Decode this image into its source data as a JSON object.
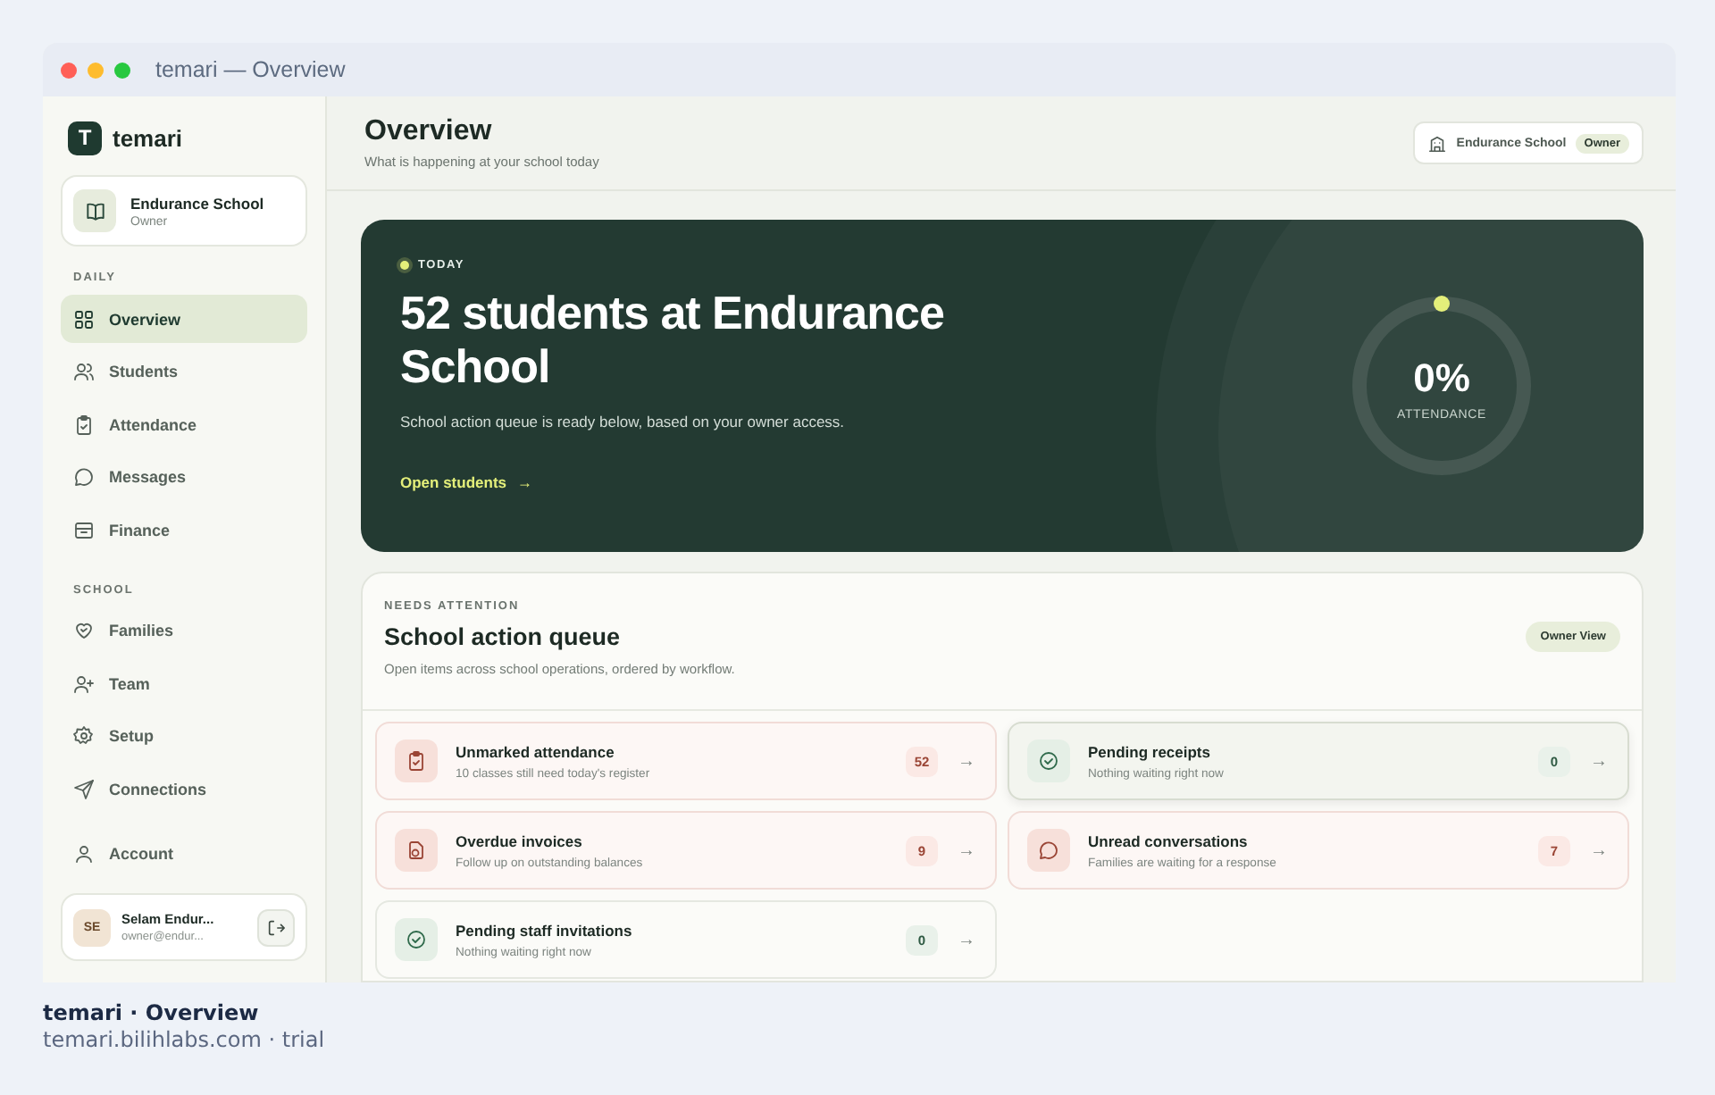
{
  "window": {
    "title": "temari — Overview"
  },
  "sidebar": {
    "brand": "temari",
    "logo_letter": "T",
    "school": {
      "name": "Endurance School",
      "role": "Owner"
    },
    "sections": [
      {
        "label": "DAILY",
        "items": [
          {
            "label": "Overview",
            "selected": true
          },
          {
            "label": "Students",
            "selected": false
          },
          {
            "label": "Attendance",
            "selected": false
          },
          {
            "label": "Messages",
            "selected": false
          },
          {
            "label": "Finance",
            "selected": false
          }
        ]
      },
      {
        "label": "SCHOOL",
        "items": [
          {
            "label": "Families",
            "selected": false
          },
          {
            "label": "Team",
            "selected": false
          },
          {
            "label": "Setup",
            "selected": false
          },
          {
            "label": "Connections",
            "selected": false
          }
        ]
      }
    ],
    "account": {
      "label": "Account",
      "selected": false
    },
    "user": {
      "initials": "SE",
      "name": "Selam Endur...",
      "email": "owner@endur..."
    }
  },
  "header": {
    "title": "Overview",
    "subtitle": "What is happening at your school today",
    "school": "Endurance School",
    "role": "Owner"
  },
  "hero": {
    "eyebrow": "TODAY",
    "title": "52 students at Endurance School",
    "text": "School action queue is ready below, based on your owner access.",
    "link": "Open students",
    "link_arrow": "→",
    "gauge": {
      "value": "0%",
      "label": "ATTENDANCE",
      "level": 0
    }
  },
  "queue": {
    "eyebrow": "NEEDS ATTENTION",
    "title": "School action queue",
    "subtitle": "Open items across school operations, ordered by workflow.",
    "badge": "Owner View",
    "items": [
      {
        "kind": "alert",
        "title": "Unmarked attendance",
        "text": "10 classes still need today's register",
        "count": "52",
        "arrow": "→",
        "selected": false
      },
      {
        "kind": "clear",
        "title": "Pending receipts",
        "text": "Nothing waiting right now",
        "count": "0",
        "arrow": "→",
        "selected": true
      },
      {
        "kind": "alert",
        "title": "Overdue invoices",
        "text": "Follow up on outstanding balances",
        "count": "9",
        "arrow": "→",
        "selected": false
      },
      {
        "kind": "alert",
        "title": "Unread conversations",
        "text": "Families are waiting for a response",
        "count": "7",
        "arrow": "→",
        "selected": false
      },
      {
        "kind": "clear",
        "title": "Pending staff invitations",
        "text": "Nothing waiting right now",
        "count": "0",
        "arrow": "→",
        "selected": false
      }
    ]
  },
  "caption": {
    "title": "temari · Overview",
    "subtitle": "temari.bilihlabs.com · trial"
  }
}
